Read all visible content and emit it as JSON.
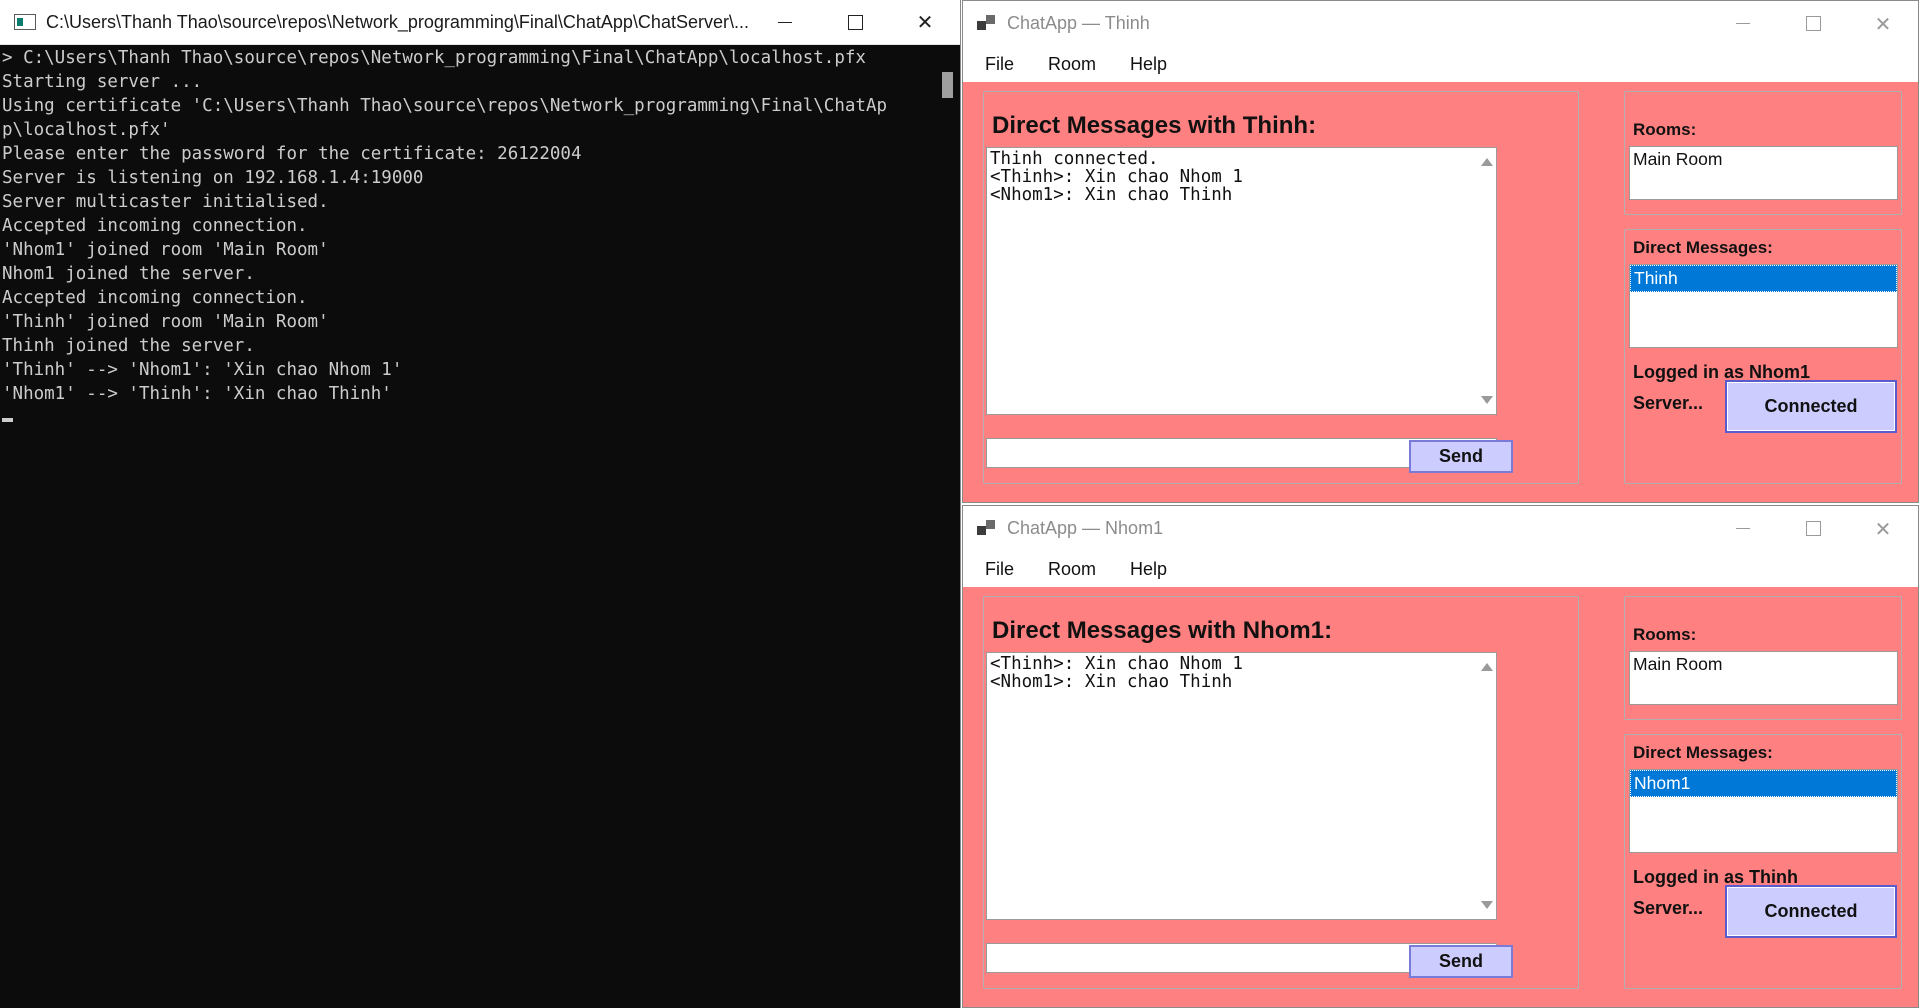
{
  "console": {
    "title": "C:\\Users\\Thanh Thao\\source\\repos\\Network_programming\\Final\\ChatApp\\ChatServer\\...",
    "output": "> C:\\Users\\Thanh Thao\\source\\repos\\Network_programming\\Final\\ChatApp\\localhost.pfx\nStarting server ...\nUsing certificate 'C:\\Users\\Thanh Thao\\source\\repos\\Network_programming\\Final\\ChatAp\np\\localhost.pfx'\nPlease enter the password for the certificate: 26122004\nServer is listening on 192.168.1.4:19000\nServer multicaster initialised.\nAccepted incoming connection.\n'Nhom1' joined room 'Main Room'\nNhom1 joined the server.\nAccepted incoming connection.\n'Thinh' joined room 'Main Room'\nThinh joined the server.\n'Thinh' --> 'Nhom1': 'Xin chao Nhom 1'\n'Nhom1' --> 'Thinh': 'Xin chao Thinh'\n"
  },
  "chat_top": {
    "title": "ChatApp — Thinh",
    "menu": [
      "File",
      "Room",
      "Help"
    ],
    "heading": "Direct Messages with Thinh:",
    "messages": "Thinh connected.\n<Thinh>: Xin chao Nhom 1\n<Nhom1>: Xin chao Thinh",
    "input_value": "",
    "send_label": "Send",
    "rooms_label": "Rooms:",
    "rooms": [
      "Main Room"
    ],
    "dm_label": "Direct Messages:",
    "dm_items": [
      "Thinh"
    ],
    "logged_in": "Logged in as Nhom1",
    "server_label": "Server...",
    "status_button": "Connected"
  },
  "chat_bottom": {
    "title": "ChatApp — Nhom1",
    "menu": [
      "File",
      "Room",
      "Help"
    ],
    "heading": "Direct Messages with Nhom1:",
    "messages": "<Thinh>: Xin chao Nhom 1\n<Nhom1>: Xin chao Thinh",
    "input_value": "",
    "send_label": "Send",
    "rooms_label": "Rooms:",
    "rooms": [
      "Main Room"
    ],
    "dm_label": "Direct Messages:",
    "dm_items": [
      "Nhom1"
    ],
    "logged_in": "Logged in as Thinh",
    "server_label": "Server...",
    "status_button": "Connected"
  },
  "icons": {
    "console_icon": "terminal-icon",
    "chat_icon": "app-window-icon",
    "minimize": "minimize-icon",
    "maximize": "maximize-icon",
    "close": "close-icon"
  },
  "colors": {
    "console_bg": "#0c0c0c",
    "console_text": "#cccccc",
    "chat_bg": "#ff8080",
    "button_bg": "#ccccff",
    "selection": "#0078d7"
  }
}
